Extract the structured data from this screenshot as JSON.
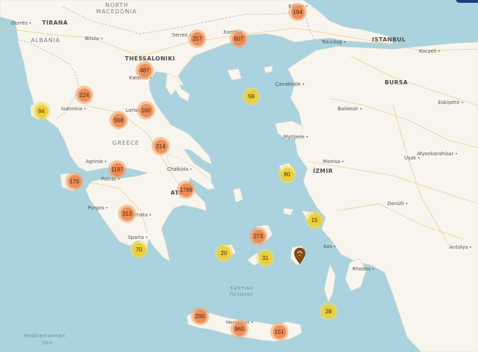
{
  "labels": {
    "countries": [
      {
        "key": "north-macedonia-1",
        "text": "NORTH"
      },
      {
        "key": "north-macedonia-2",
        "text": "MACEDONIA"
      },
      {
        "key": "albania",
        "text": "ALBANIA"
      },
      {
        "key": "greece",
        "text": "GREECE"
      }
    ],
    "major_cities": [
      {
        "key": "tirana",
        "text": "TIRANA"
      },
      {
        "key": "thessaloniki",
        "text": "THESSALONIKI"
      },
      {
        "key": "istanbul",
        "text": "ISTANBUL"
      },
      {
        "key": "bursa",
        "text": "BURSA"
      },
      {
        "key": "izmir",
        "text": "İZMIR"
      },
      {
        "key": "athens",
        "text": "ATH"
      }
    ],
    "cities": [
      {
        "key": "durres",
        "text": "Durrës"
      },
      {
        "key": "bitola",
        "text": "Bitola"
      },
      {
        "key": "serres",
        "text": "Serres"
      },
      {
        "key": "xanthi",
        "text": "Xanthi"
      },
      {
        "key": "edirne",
        "text": "Edirne"
      },
      {
        "key": "tekirdag",
        "text": "Tekirdağ"
      },
      {
        "key": "kocaeli",
        "text": "Kocaeli"
      },
      {
        "key": "katerini",
        "text": "Katerini"
      },
      {
        "key": "canakkale",
        "text": "Çanakkale"
      },
      {
        "key": "balikesir",
        "text": "Balıkesir"
      },
      {
        "key": "eskisehir",
        "text": "Eskişehir"
      },
      {
        "key": "ioannina",
        "text": "Ioannina"
      },
      {
        "key": "larissa",
        "text": "Larissa"
      },
      {
        "key": "mytilene",
        "text": "Mytilene"
      },
      {
        "key": "manisa",
        "text": "Manisa"
      },
      {
        "key": "afyonkarahisar",
        "text": "Afyonkarahisar"
      },
      {
        "key": "usak",
        "text": "Uşak"
      },
      {
        "key": "agrinio",
        "text": "Agrinio"
      },
      {
        "key": "chalkida",
        "text": "Chalkida"
      },
      {
        "key": "patras",
        "text": "Patras"
      },
      {
        "key": "pyrgos",
        "text": "Pyrgos"
      },
      {
        "key": "kalamata",
        "text": "amata"
      },
      {
        "key": "sparta",
        "text": "Sparta"
      },
      {
        "key": "denizli",
        "text": "Denizli"
      },
      {
        "key": "kos",
        "text": "Kos"
      },
      {
        "key": "rhodes",
        "text": "Rhodes"
      },
      {
        "key": "antalya",
        "text": "Antalya"
      },
      {
        "key": "heraklion",
        "text": "Heraklion"
      }
    ],
    "seas": [
      {
        "key": "cretan-sea-1",
        "text": "Κρητικό"
      },
      {
        "key": "cretan-sea-2",
        "text": "Πέλαγος"
      },
      {
        "key": "mediterranean-1",
        "text": "Mediterranean"
      },
      {
        "key": "mediterranean-2",
        "text": "Sea"
      }
    ]
  },
  "clusters": [
    {
      "key": "edirne",
      "count": "194",
      "level": "orange"
    },
    {
      "key": "serres",
      "count": "257",
      "level": "orange"
    },
    {
      "key": "xanthi",
      "count": "607",
      "level": "orange"
    },
    {
      "key": "katerini",
      "count": "487",
      "level": "orange"
    },
    {
      "key": "ioannina",
      "count": "224",
      "level": "orange"
    },
    {
      "key": "corfu",
      "count": "94",
      "level": "yellow"
    },
    {
      "key": "larissa",
      "count": "160",
      "level": "orange"
    },
    {
      "key": "trikala",
      "count": "568",
      "level": "orange"
    },
    {
      "key": "lesbos-north",
      "count": "58",
      "level": "yellow"
    },
    {
      "key": "volos",
      "count": "214",
      "level": "orange"
    },
    {
      "key": "agrinio",
      "count": "1197",
      "level": "orange"
    },
    {
      "key": "kefalonia",
      "count": "176",
      "level": "orange"
    },
    {
      "key": "chios",
      "count": "80",
      "level": "yellow"
    },
    {
      "key": "athens",
      "count": "1789",
      "level": "orange"
    },
    {
      "key": "kalamata",
      "count": "313",
      "level": "orange"
    },
    {
      "key": "samos-south",
      "count": "15",
      "level": "yellow"
    },
    {
      "key": "naxos",
      "count": "273",
      "level": "orange"
    },
    {
      "key": "laconia",
      "count": "70",
      "level": "yellow"
    },
    {
      "key": "milos",
      "count": "20",
      "level": "yellow"
    },
    {
      "key": "santorini",
      "count": "31",
      "level": "yellow"
    },
    {
      "key": "karpathos",
      "count": "28",
      "level": "yellow"
    },
    {
      "key": "chania",
      "count": "290",
      "level": "orange"
    },
    {
      "key": "heraklion",
      "count": "965",
      "level": "orange"
    },
    {
      "key": "lasithi",
      "count": "151",
      "level": "orange"
    }
  ],
  "colors": {
    "sea": "#aad3df",
    "land": "#f7f5ee",
    "cluster_orange": "#ee8650",
    "cluster_yellow": "#ecce32",
    "pin": "#8a4a10"
  },
  "icons": {
    "pin": "map-pin-icon"
  }
}
